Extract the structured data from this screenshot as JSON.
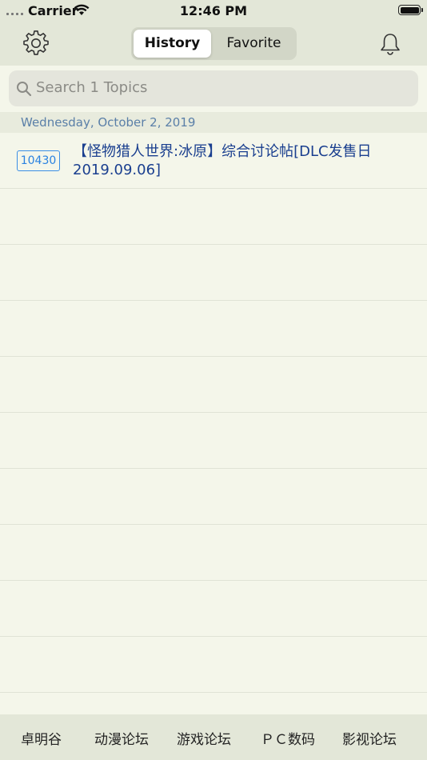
{
  "status_bar": {
    "carrier": "Carrier",
    "time": "12:46 PM"
  },
  "nav": {
    "segments": [
      "History",
      "Favorite"
    ],
    "selected_segment": "History",
    "left_icon": "gear-icon",
    "right_icon": "bell-icon"
  },
  "search": {
    "placeholder": "Search 1 Topics"
  },
  "sections": [
    {
      "date": "Wednesday, October 2, 2019",
      "items": [
        {
          "replies": "10430",
          "title": "【怪物猎人世界:冰原】综合讨论帖[DLC发售日2019.09.06]"
        }
      ]
    }
  ],
  "tab_bar": {
    "tabs": [
      "卓明谷",
      "动漫论坛",
      "游戏论坛",
      "ＰＣ数码",
      "影视论坛"
    ]
  },
  "colors": {
    "background": "#f4f6ea",
    "bar": "#e3e7d8",
    "link": "#1a3f8f",
    "badge": "#2a82e0",
    "section_text": "#5a7fa8"
  }
}
